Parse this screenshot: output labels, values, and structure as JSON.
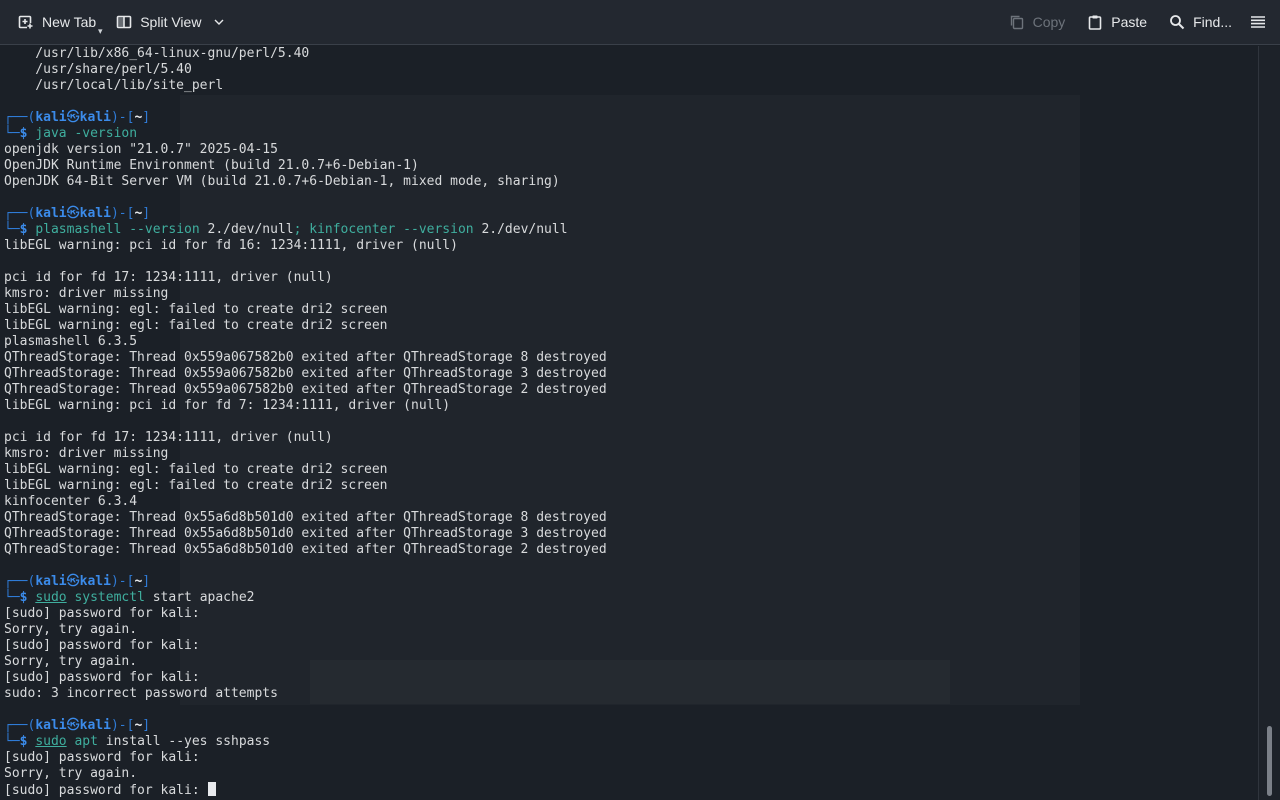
{
  "toolbar": {
    "new_tab": "New Tab",
    "split_view": "Split View",
    "copy": "Copy",
    "paste": "Paste",
    "find": "Find..."
  },
  "prompt": {
    "user": "kali",
    "host": "kali",
    "dir": "~"
  },
  "terminal": {
    "lines": [
      {
        "t": "out",
        "text": "    /usr/lib/x86_64-linux-gnu/perl/5.40"
      },
      {
        "t": "out",
        "text": "    /usr/share/perl/5.40"
      },
      {
        "t": "out",
        "text": "    /usr/local/lib/site_perl"
      },
      {
        "t": "blank"
      },
      {
        "t": "prompt"
      },
      {
        "t": "cmd",
        "parts": [
          {
            "c": "cmd",
            "s": "java"
          },
          {
            "c": "cmd",
            "s": " -version"
          }
        ]
      },
      {
        "t": "out",
        "text": "openjdk version \"21.0.7\" 2025-04-15"
      },
      {
        "t": "out",
        "text": "OpenJDK Runtime Environment (build 21.0.7+6-Debian-1)"
      },
      {
        "t": "out",
        "text": "OpenJDK 64-Bit Server VM (build 21.0.7+6-Debian-1, mixed mode, sharing)"
      },
      {
        "t": "blank"
      },
      {
        "t": "prompt"
      },
      {
        "t": "cmd",
        "parts": [
          {
            "c": "cmd",
            "s": "plasmashell"
          },
          {
            "c": "cmd",
            "s": " --version "
          },
          {
            "c": "arg",
            "s": "2./dev/null"
          },
          {
            "c": "cmd",
            "s": "; kinfocenter"
          },
          {
            "c": "cmd",
            "s": " --version "
          },
          {
            "c": "arg",
            "s": "2./dev/null"
          }
        ]
      },
      {
        "t": "out",
        "text": "libEGL warning: pci id for fd 16: 1234:1111, driver (null)"
      },
      {
        "t": "blank"
      },
      {
        "t": "out",
        "text": "pci id for fd 17: 1234:1111, driver (null)"
      },
      {
        "t": "out",
        "text": "kmsro: driver missing"
      },
      {
        "t": "out",
        "text": "libEGL warning: egl: failed to create dri2 screen"
      },
      {
        "t": "out",
        "text": "libEGL warning: egl: failed to create dri2 screen"
      },
      {
        "t": "out",
        "text": "plasmashell 6.3.5"
      },
      {
        "t": "out",
        "text": "QThreadStorage: Thread 0x559a067582b0 exited after QThreadStorage 8 destroyed"
      },
      {
        "t": "out",
        "text": "QThreadStorage: Thread 0x559a067582b0 exited after QThreadStorage 3 destroyed"
      },
      {
        "t": "out",
        "text": "QThreadStorage: Thread 0x559a067582b0 exited after QThreadStorage 2 destroyed"
      },
      {
        "t": "out",
        "text": "libEGL warning: pci id for fd 7: 1234:1111, driver (null)"
      },
      {
        "t": "blank"
      },
      {
        "t": "out",
        "text": "pci id for fd 17: 1234:1111, driver (null)"
      },
      {
        "t": "out",
        "text": "kmsro: driver missing"
      },
      {
        "t": "out",
        "text": "libEGL warning: egl: failed to create dri2 screen"
      },
      {
        "t": "out",
        "text": "libEGL warning: egl: failed to create dri2 screen"
      },
      {
        "t": "out",
        "text": "kinfocenter 6.3.4"
      },
      {
        "t": "out",
        "text": "QThreadStorage: Thread 0x55a6d8b501d0 exited after QThreadStorage 8 destroyed"
      },
      {
        "t": "out",
        "text": "QThreadStorage: Thread 0x55a6d8b501d0 exited after QThreadStorage 3 destroyed"
      },
      {
        "t": "out",
        "text": "QThreadStorage: Thread 0x55a6d8b501d0 exited after QThreadStorage 2 destroyed"
      },
      {
        "t": "blank"
      },
      {
        "t": "prompt"
      },
      {
        "t": "cmd",
        "parts": [
          {
            "c": "sudo",
            "s": "sudo"
          },
          {
            "c": "cmd",
            "s": " systemctl"
          },
          {
            "c": "arg",
            "s": " start apache2"
          }
        ]
      },
      {
        "t": "out",
        "text": "[sudo] password for kali:"
      },
      {
        "t": "out",
        "text": "Sorry, try again."
      },
      {
        "t": "out",
        "text": "[sudo] password for kali:"
      },
      {
        "t": "out",
        "text": "Sorry, try again."
      },
      {
        "t": "out",
        "text": "[sudo] password for kali:"
      },
      {
        "t": "out",
        "text": "sudo: 3 incorrect password attempts"
      },
      {
        "t": "blank"
      },
      {
        "t": "prompt"
      },
      {
        "t": "cmd",
        "parts": [
          {
            "c": "sudo",
            "s": "sudo"
          },
          {
            "c": "cmd",
            "s": " apt"
          },
          {
            "c": "arg",
            "s": " install --yes sshpass"
          }
        ]
      },
      {
        "t": "out",
        "text": "[sudo] password for kali:"
      },
      {
        "t": "out",
        "text": "Sorry, try again."
      },
      {
        "t": "outcursor",
        "text": "[sudo] password for kali: "
      }
    ]
  }
}
